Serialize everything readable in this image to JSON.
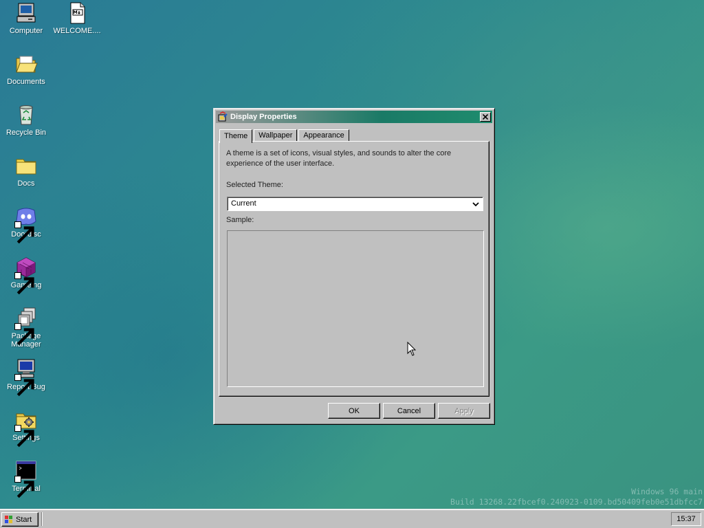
{
  "desktop": {
    "icons": [
      {
        "label": "Computer",
        "icon": "computer-icon"
      },
      {
        "label": "WELCOME....",
        "icon": "markdown-file-icon"
      },
      {
        "label": "Documents",
        "icon": "open-folder-icon"
      },
      {
        "label": "Recycle Bin",
        "icon": "recycle-bin-icon"
      },
      {
        "label": "Docs",
        "icon": "folder-icon"
      },
      {
        "label": "Doordisc",
        "icon": "chat-app-icon"
      },
      {
        "label": "Gameing",
        "icon": "game-cube-icon"
      },
      {
        "label": "Package Manager",
        "icon": "package-manager-icon"
      },
      {
        "label": "Report Bug",
        "icon": "monitor-bug-icon"
      },
      {
        "label": "Settings",
        "icon": "settings-folder-icon"
      },
      {
        "label": "Terminal",
        "icon": "terminal-icon"
      }
    ],
    "watermark": {
      "line1": "Windows 96 main",
      "line2": "Build 13268.22fbcef0.240923-0109.bd50409feb0e51dbfcc7"
    }
  },
  "dialog": {
    "title": "Display Properties",
    "tabs": [
      "Theme",
      "Wallpaper",
      "Appearance"
    ],
    "active_tab": "Theme",
    "description": "A theme is a set of icons, visual styles, and sounds to alter the core experience of the user interface.",
    "selected_theme_label": "Selected Theme:",
    "selected_theme_value": "Current",
    "sample_label": "Sample:",
    "buttons": {
      "ok": "OK",
      "cancel": "Cancel",
      "apply": "Apply"
    }
  },
  "taskbar": {
    "start_label": "Start",
    "clock": "15:37"
  },
  "colors": {
    "titlebar_active": "#1a7a66",
    "window_face": "#c0c0c0",
    "desktop": "#2d8a8e"
  }
}
